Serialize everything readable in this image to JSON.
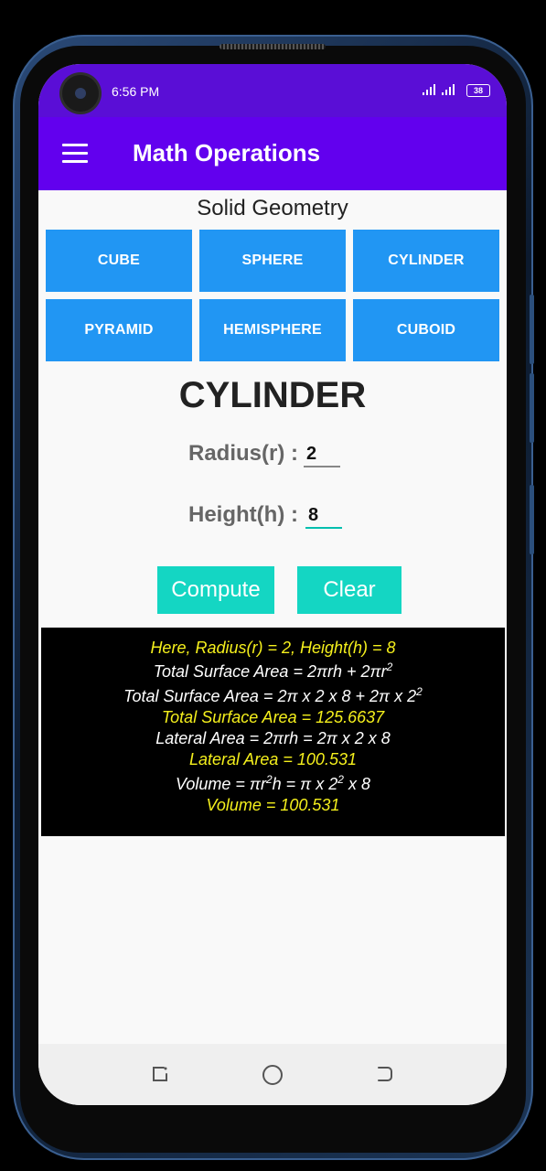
{
  "status_bar": {
    "time": "6:56 PM",
    "battery": "38"
  },
  "app_bar": {
    "title": "Math Operations"
  },
  "section_title": "Solid Geometry",
  "shapes": [
    "CUBE",
    "SPHERE",
    "CYLINDER",
    "PYRAMID",
    "HEMISPHERE",
    "CUBOID"
  ],
  "selected_shape": "CYLINDER",
  "inputs": {
    "radius": {
      "label": "Radius(r) :",
      "value": "2"
    },
    "height": {
      "label": "Height(h) :",
      "value": "8"
    }
  },
  "actions": {
    "compute": "Compute",
    "clear": "Clear"
  },
  "results": {
    "given": "Here, Radius(r) = 2, Height(h) = 8",
    "tsa_formula": {
      "pre": "Total Surface Area = 2πrh + 2πr",
      "sup": "2"
    },
    "tsa_substituted": {
      "pre": "Total Surface Area = 2π x 2 x 8 + 2π x 2",
      "sup": "2"
    },
    "tsa_result": "Total Surface Area = 125.6637",
    "lateral_formula": "Lateral Area = 2πrh = 2π x 2 x 8",
    "lateral_result": "Lateral Area = 100.531",
    "volume_formula": {
      "a": "Volume = πr",
      "sup1": "2",
      "b": "h = π x 2",
      "sup2": "2",
      "c": " x 8"
    },
    "volume_result": "Volume = 100.531"
  },
  "colors": {
    "status_bar": "#5a0ed6",
    "app_bar": "#6200ee",
    "shape_button": "#2196f3",
    "action_button": "#14d6c3",
    "result_highlight": "#f5f01c"
  },
  "icons": {
    "menu": "hamburger-icon",
    "nav_recent": "recent-apps-icon",
    "nav_home": "home-icon",
    "nav_back": "back-icon"
  }
}
